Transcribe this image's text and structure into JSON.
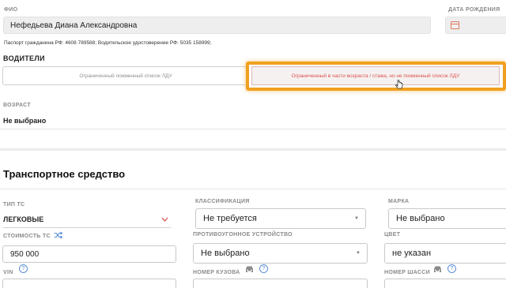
{
  "person": {
    "fio_label": "ФИО",
    "fio_value": "Нефедьева Диана Александровна",
    "birth_label": "ДАТА РОЖДЕНИЯ",
    "documents": "Паспорт гражданина РФ: 4608 789588; Водительское удостоверение РФ: 5035 158999;"
  },
  "drivers": {
    "title": "ВОДИТЕЛИ",
    "option_named": "Ограниченный поименный список ЛДУ",
    "option_age": "Ограниченный в части возраста / стажа, но не поименный список ЛДУ",
    "age_label": "ВОЗРАСТ",
    "age_value": "Не выбрано"
  },
  "vehicle": {
    "title": "Транспортное средство",
    "type_label": "ТИП ТС",
    "type_value": "ЛЕГКОВЫЕ",
    "class_label": "КЛАССИФИКАЦИЯ",
    "class_value": "Не требуется",
    "brand_label": "МАРКА",
    "brand_value": "Не выбрано",
    "cost_label": "СТОИМОСТЬ ТС",
    "cost_value": "950 000",
    "antitheft_label": "ПРОТИВОУГОННОЕ УСТРОЙСТВО",
    "antitheft_value": "Не выбрано",
    "color_label": "ЦВЕТ",
    "color_value": "не указан",
    "vin_label": "VIN",
    "body_label": "НОМЕР КУЗОВА",
    "chassis_label": "НОМЕР ШАССИ"
  },
  "icons": {
    "calendar": "calendar-icon",
    "shuffle": "shuffle-icon",
    "help": "help-icon",
    "car": "car-icon",
    "cursor": "cursor-icon"
  },
  "colors": {
    "highlight": "#f0a020",
    "active_text": "#d9534f",
    "help": "#5b8fd6"
  }
}
